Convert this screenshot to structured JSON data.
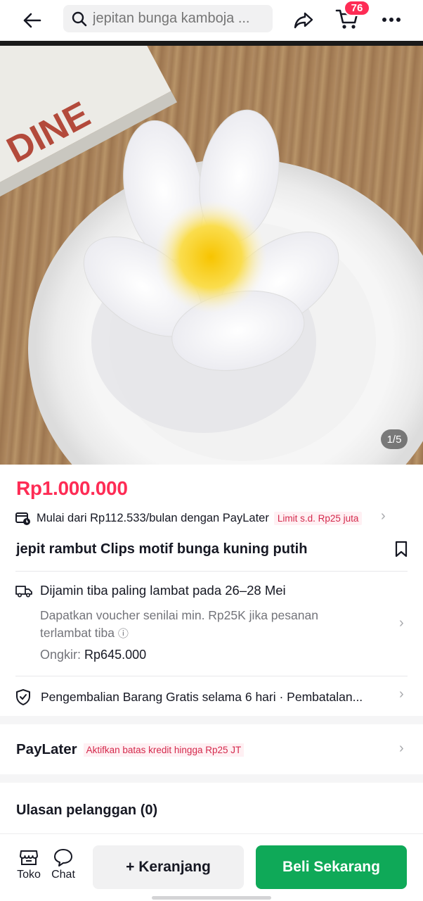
{
  "header": {
    "search_placeholder": "jepitan bunga kamboja ...",
    "cart_count": "76"
  },
  "gallery": {
    "counter": "1/5",
    "box_text": "DINE"
  },
  "product": {
    "price": "Rp1.000.000",
    "paylater_text": "Mulai dari Rp112.533/bulan dengan PayLater",
    "paylater_limit": "Limit s.d. Rp25 juta",
    "title": "jepit rambut Clips motif bunga kuning putih"
  },
  "shipping": {
    "guarantee": "Dijamin tiba paling lambat pada 26–28 Mei",
    "voucher": "Dapatkan voucher senilai min. Rp25K jika pesanan terlambat tiba",
    "shipping_label": "Ongkir:",
    "shipping_cost": "Rp645.000"
  },
  "returns": {
    "text": "Pengembalian Barang Gratis selama 6 hari · Pembatalan..."
  },
  "paylater_section": {
    "label": "PayLater",
    "badge": "Aktifkan batas kredit hingga Rp25 JT"
  },
  "reviews": {
    "title": "Ulasan pelanggan (0)"
  },
  "bottom_bar": {
    "shop_label": "Toko",
    "chat_label": "Chat",
    "add_to_cart": "+ Keranjang",
    "buy_now": "Beli Sekarang"
  },
  "colors": {
    "accent_red": "#fe2c55",
    "buy_green": "#0fa958"
  }
}
